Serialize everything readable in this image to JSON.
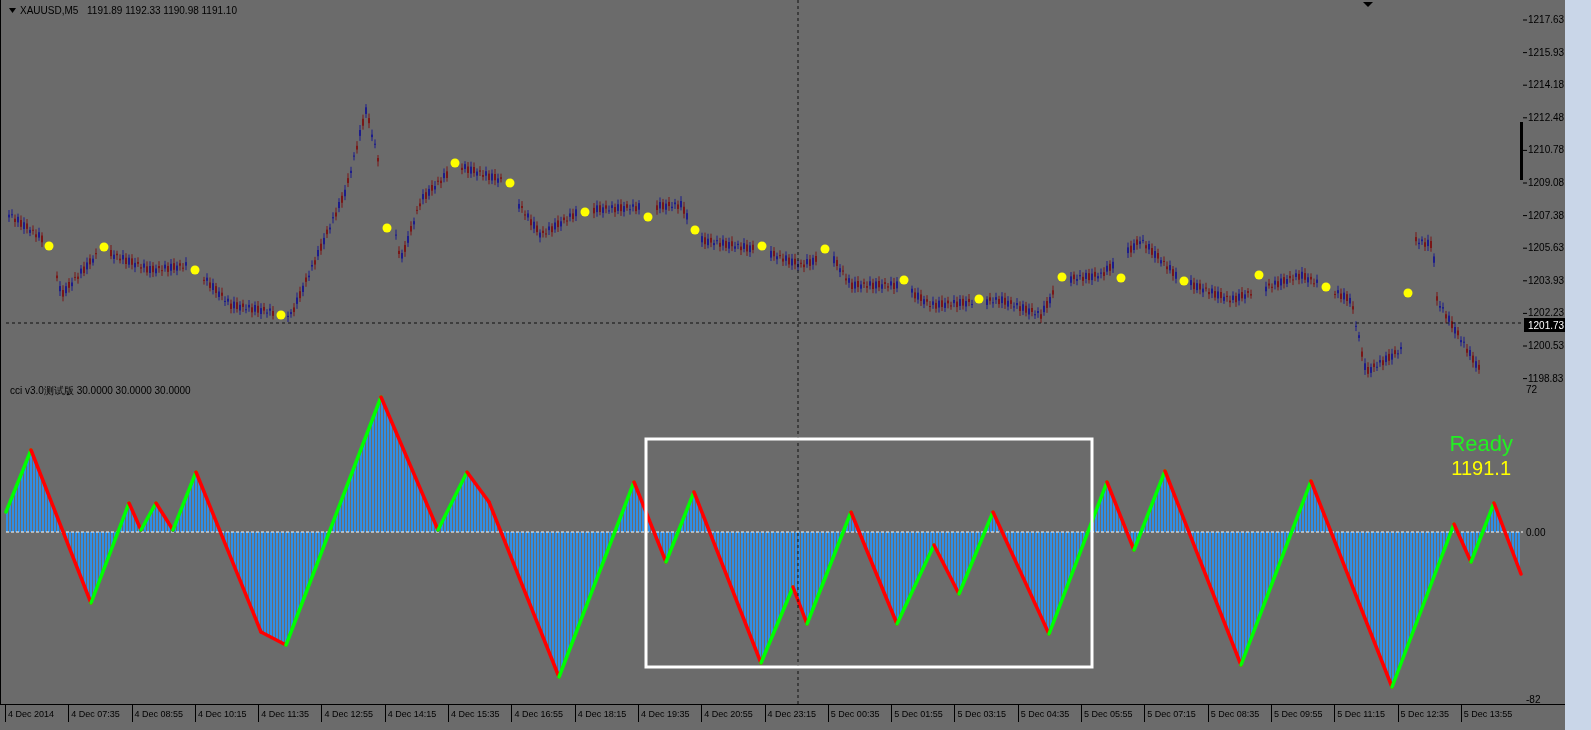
{
  "chart": {
    "symbol": "XAUUSD,M5",
    "ohlc": "1191.89 1192.33 1190.98 1191.10",
    "price_axis": [
      "1217.63",
      "1215.93",
      "1214.18",
      "1212.48",
      "1210.78",
      "1209.08",
      "1207.38",
      "1205.63",
      "1203.93",
      "1202.23",
      "1200.53",
      "1198.83"
    ],
    "current_price": "1201.73"
  },
  "indicator": {
    "title": "cci v3.0测试版 30.0000 30.0000 30.0000",
    "status": "Ready",
    "value": "1191.1",
    "axis": [
      "72",
      "0.00",
      "-82"
    ]
  },
  "time_axis": [
    "4 Dec 2014",
    "4 Dec 07:35",
    "4 Dec 08:55",
    "4 Dec 10:15",
    "4 Dec 11:35",
    "4 Dec 12:55",
    "4 Dec 14:15",
    "4 Dec 15:35",
    "4 Dec 16:55",
    "4 Dec 18:15",
    "4 Dec 19:35",
    "4 Dec 20:55",
    "4 Dec 23:15",
    "5 Dec 00:35",
    "5 Dec 01:55",
    "5 Dec 03:15",
    "5 Dec 04:35",
    "5 Dec 05:55",
    "5 Dec 07:15",
    "5 Dec 08:35",
    "5 Dec 09:55",
    "5 Dec 11:15",
    "5 Dec 12:35",
    "5 Dec 13:55"
  ]
}
